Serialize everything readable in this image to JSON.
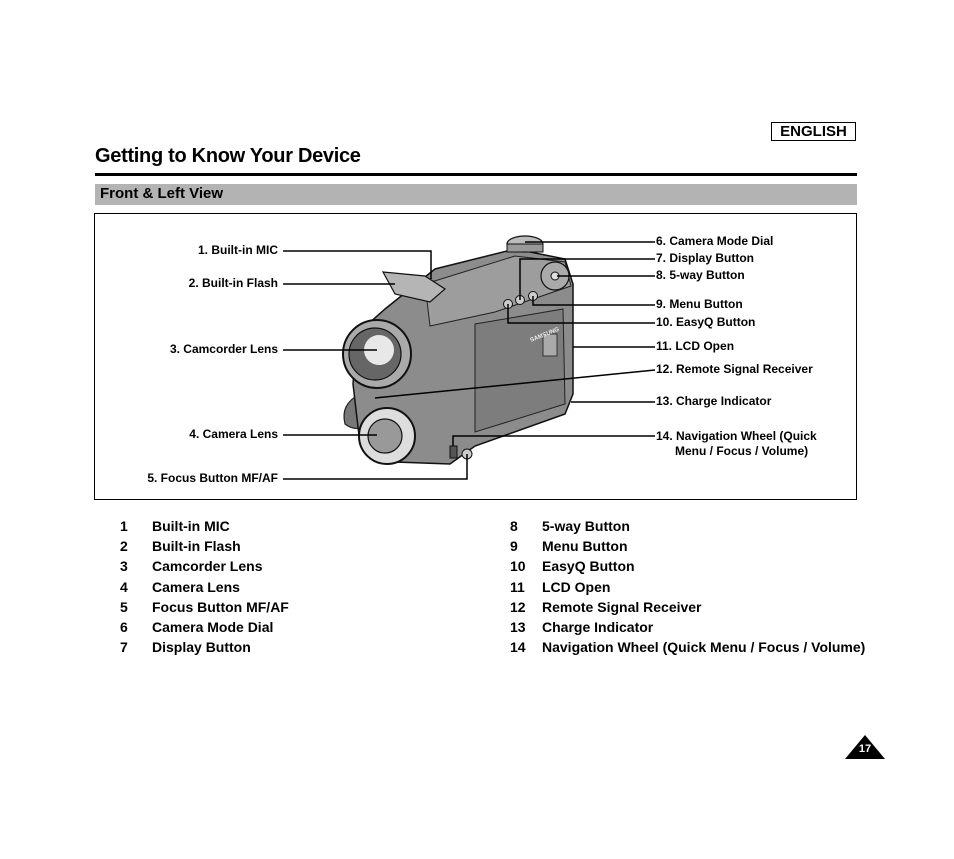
{
  "header": {
    "language_badge": "ENGLISH",
    "title": "Getting to Know Your Device",
    "section_title": "Front & Left View"
  },
  "diagram": {
    "image": "camcorder-front-left-illustration",
    "brand_mark": "SAMSUNG",
    "callouts_left": [
      {
        "label": "1. Built-in MIC"
      },
      {
        "label": "2. Built-in Flash"
      },
      {
        "label": "3. Camcorder Lens"
      },
      {
        "label": "4. Camera Lens"
      },
      {
        "label": "5. Focus Button MF/AF"
      }
    ],
    "callouts_right": [
      {
        "label": "6. Camera Mode Dial"
      },
      {
        "label": "7. Display Button"
      },
      {
        "label": "8. 5-way Button"
      },
      {
        "label": "9. Menu Button"
      },
      {
        "label": "10. EasyQ Button"
      },
      {
        "label": "11. LCD Open"
      },
      {
        "label": "12. Remote Signal Receiver"
      },
      {
        "label": "13. Charge Indicator"
      },
      {
        "label": "14. Navigation Wheel (Quick",
        "label_line2": "Menu / Focus / Volume)"
      }
    ]
  },
  "parts_list": {
    "left": [
      {
        "num": "1",
        "label": "Built-in MIC"
      },
      {
        "num": "2",
        "label": "Built-in Flash"
      },
      {
        "num": "3",
        "label": "Camcorder Lens"
      },
      {
        "num": "4",
        "label": "Camera Lens"
      },
      {
        "num": "5",
        "label": "Focus Button MF/AF"
      },
      {
        "num": "6",
        "label": "Camera Mode Dial"
      },
      {
        "num": "7",
        "label": "Display Button"
      }
    ],
    "right": [
      {
        "num": "8",
        "label": "5-way Button"
      },
      {
        "num": "9",
        "label": "Menu Button"
      },
      {
        "num": "10",
        "label": "EasyQ Button"
      },
      {
        "num": "11",
        "label": "LCD Open"
      },
      {
        "num": "12",
        "label": "Remote Signal Receiver"
      },
      {
        "num": "13",
        "label": "Charge Indicator"
      },
      {
        "num": "14",
        "label": "Navigation Wheel (Quick Menu / Focus / Volume)"
      }
    ]
  },
  "footer": {
    "page_number": "17"
  }
}
